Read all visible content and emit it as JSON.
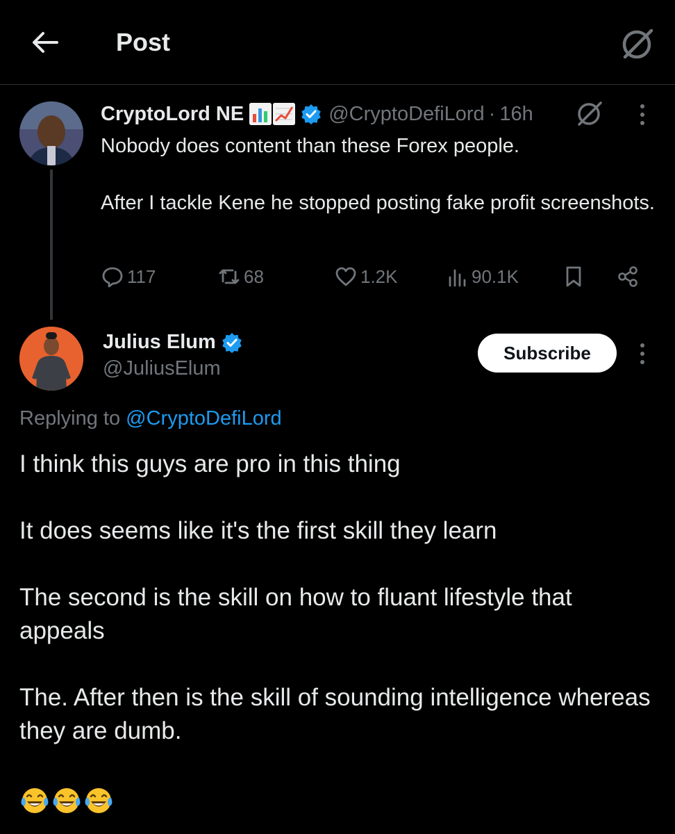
{
  "header": {
    "title": "Post",
    "back_icon": "arrow-left-icon",
    "grok_icon": "grok-icon"
  },
  "parent_post": {
    "author_name": "CryptoLord NE",
    "name_emojis": [
      "bar-chart-emoji",
      "chart-increasing-emoji"
    ],
    "verified": true,
    "handle": "@CryptoDefiLord",
    "separator": "·",
    "time": "16h",
    "text": "Nobody does content than these Forex people.\n\nAfter I tackle Kene he stopped posting fake profit screenshots.",
    "stats": {
      "replies": "117",
      "reposts": "68",
      "likes": "1.2K",
      "views": "90.1K"
    }
  },
  "reply_post": {
    "author_name": "Julius Elum",
    "verified": true,
    "handle": "@JuliusElum",
    "subscribe_label": "Subscribe",
    "replying_prefix": "Replying to ",
    "replying_to": "@CryptoDefiLord",
    "text": "I think this guys are pro in this thing\n\nIt does seems like it's the first skill they learn\n\nThe second is the skill on how to fluant lifestyle that appeals\n\nThe. After then is the skill of sounding intelligence whereas they are dumb.",
    "emojis": [
      "face-with-tears-of-joy",
      "face-with-tears-of-joy",
      "face-with-tears-of-joy"
    ]
  },
  "colors": {
    "background": "#000000",
    "text": "#e7e9ea",
    "muted": "#71767b",
    "accent": "#1d9bf0",
    "divider": "#2f3336"
  }
}
